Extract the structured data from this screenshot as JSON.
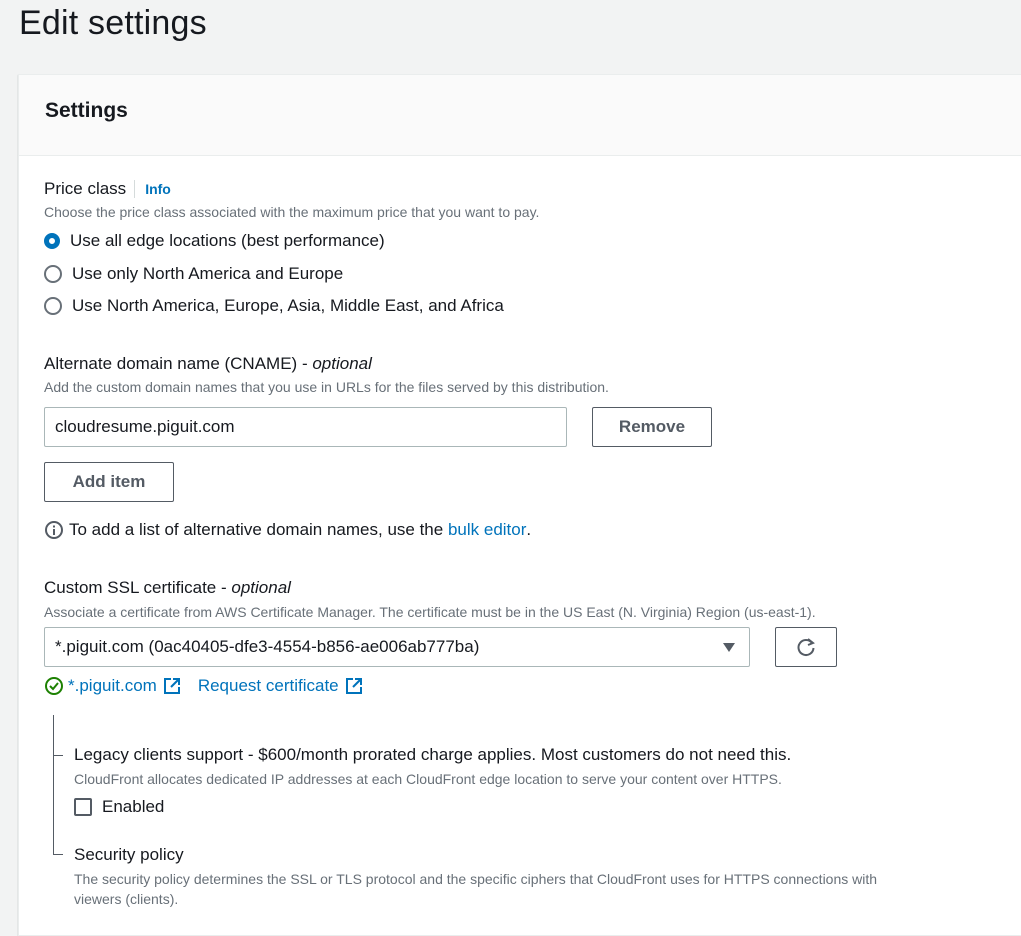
{
  "page": {
    "title": "Edit settings"
  },
  "settings": {
    "title": "Settings",
    "price_class": {
      "label": "Price class",
      "info": "Info",
      "description": "Choose the price class associated with the maximum price that you want to pay.",
      "options": [
        {
          "label": "Use all edge locations (best performance)",
          "selected": true
        },
        {
          "label": "Use only North America and Europe",
          "selected": false
        },
        {
          "label": "Use North America, Europe, Asia, Middle East, and Africa",
          "selected": false
        }
      ]
    },
    "cname": {
      "label": "Alternate domain name (CNAME)",
      "optional": "optional",
      "description": "Add the custom domain names that you use in URLs for the files served by this distribution.",
      "value": "cloudresume.piguit.com",
      "remove_label": "Remove",
      "add_label": "Add item",
      "hint_prefix": "To add a list of alternative domain names, use the",
      "hint_link": "bulk editor",
      "hint_suffix": "."
    },
    "ssl": {
      "label": "Custom SSL certificate",
      "optional": "optional",
      "description": "Associate a certificate from AWS Certificate Manager. The certificate must be in the US East (N. Virginia) Region (us-east-1).",
      "selected": "*.piguit.com (0ac40405-dfe3-4554-b856-ae006ab777ba)",
      "status_link": "*.piguit.com",
      "request_link": "Request certificate"
    },
    "legacy": {
      "label": "Legacy clients support - $600/month prorated charge applies. Most customers do not need this.",
      "description": "CloudFront allocates dedicated IP addresses at each CloudFront edge location to serve your content over HTTPS.",
      "checkbox_label": "Enabled",
      "checked": false
    },
    "security_policy": {
      "label": "Security policy",
      "description_line1": "The security policy determines the SSL or TLS protocol and the specific ciphers that CloudFront uses for HTTPS connections with",
      "description_line2": "viewers (clients)."
    }
  },
  "colors": {
    "accent": "#0073bb",
    "success": "#1d8102",
    "text": "#16191f",
    "muted": "#687078"
  }
}
